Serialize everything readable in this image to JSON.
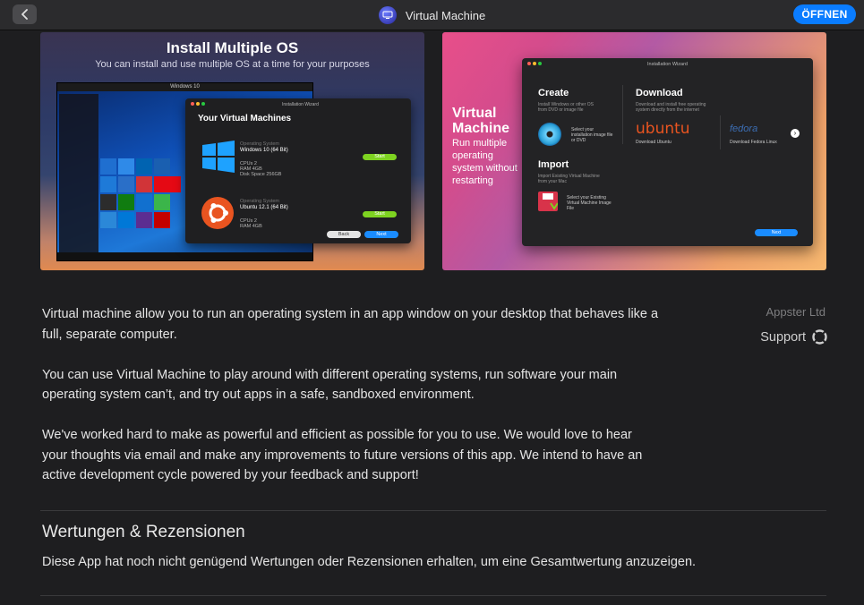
{
  "window": {
    "title": "Virtual Machine",
    "open_button": "ÖFFNEN"
  },
  "screenshot1": {
    "title": "Install Multiple OS",
    "subtitle": "You can install and use multiple OS at a time for your purposes",
    "win10_title": "Windows 10",
    "vm_window_title": "Installation Wizard",
    "vm_heading": "Your Virtual Machines",
    "vm1_os_label": "Operating System",
    "vm1_os": "Windows 10 (64 Bit)",
    "vm1_cpu": "CPUs 2",
    "vm1_ram": "RAM 4GB",
    "vm1_disk": "Disk Space 256GB",
    "vm2_os_label": "Operating System",
    "vm2_os": "Ubuntu 12.1 (64 Bit)",
    "vm2_cpu": "CPUs 2",
    "vm2_ram": "RAM 4GB",
    "start1": "Start",
    "start2": "Start",
    "back": "Back",
    "next": "Next"
  },
  "screenshot2": {
    "title_line1": "Virtual",
    "title_line2": "Machine",
    "subtitle": "Run multiple operating system without restarting",
    "wizard_title": "Installation Wizard",
    "create": "Create",
    "create_desc": "Install Windows or other OS from DVD or image file",
    "create_item": "Select your installation image file or DVD",
    "download": "Download",
    "download_desc": "Download and install free operating system directly from the internet",
    "ubuntu": "ubuntu",
    "ubuntu_caption": "Download Ubuntu",
    "fedora": "fedora",
    "fedora_caption": "Download Fedora Linux",
    "import": "Import",
    "import_desc": "Import Existing Virtual Machine from your Mac",
    "import_item": "Select your Existing Virtual Machine Image File",
    "next": "Next"
  },
  "description": {
    "p1": "Virtual machine allow you to run an operating system in an app window on your desktop that behaves like a full, separate computer.",
    "p2": "You can use Virtual Machine to play around with different operating systems, run software your main operating system can’t, and try out apps in a safe, sandboxed environment.",
    "p3": "We've worked hard to make  as powerful and efficient as possible for you to use. We would love to hear your thoughts via email and make any improvements to future versions of this app. We intend to have an active development cycle powered by your feedback and support!"
  },
  "sidebar": {
    "developer": "Appster Ltd",
    "support": "Support"
  },
  "ratings": {
    "heading": "Wertungen & Rezensionen",
    "text": "Diese App hat noch nicht genügend Wertungen oder Rezensionen erhalten, um eine Gesamtwertung anzuzeigen."
  },
  "colors": {
    "accent": "#0a7cff",
    "background": "#1e1e20"
  },
  "icons": [
    "chevron-left-icon",
    "app-icon",
    "lifebuoy-icon"
  ]
}
